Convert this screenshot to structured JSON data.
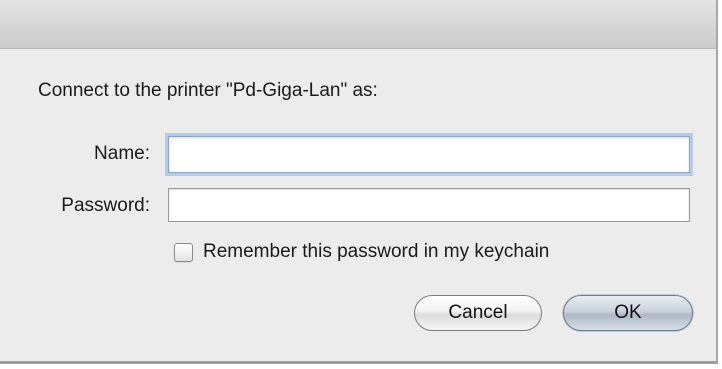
{
  "dialog": {
    "prompt": "Connect to the printer \"Pd-Giga-Lan\" as:",
    "name_label": "Name:",
    "name_value": "",
    "password_label": "Password:",
    "password_value": "",
    "remember_label": "Remember this password in my keychain",
    "remember_checked": false,
    "cancel_label": "Cancel",
    "ok_label": "OK",
    "focus_ring_color": "#b7cbe6",
    "default_button_color": "#aeb9c6"
  }
}
